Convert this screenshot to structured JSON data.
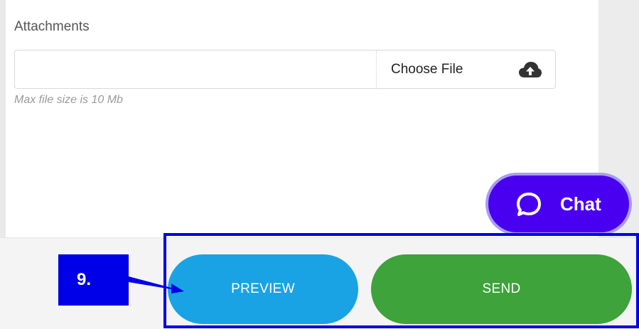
{
  "attachments": {
    "label": "Attachments",
    "file_input_value": "",
    "choose_file_label": "Choose File",
    "upload_icon": "cloud-upload-icon",
    "hint": "Max file size is 10 Mb"
  },
  "chat": {
    "label": "Chat",
    "icon": "chat-bubble-icon",
    "color": "#4a00f0"
  },
  "actions": {
    "preview_label": "PREVIEW",
    "send_label": "SEND",
    "preview_color": "#1aa3e4",
    "send_color": "#3da33a"
  },
  "annotation": {
    "step_label": "9.",
    "color": "#0000e8"
  }
}
